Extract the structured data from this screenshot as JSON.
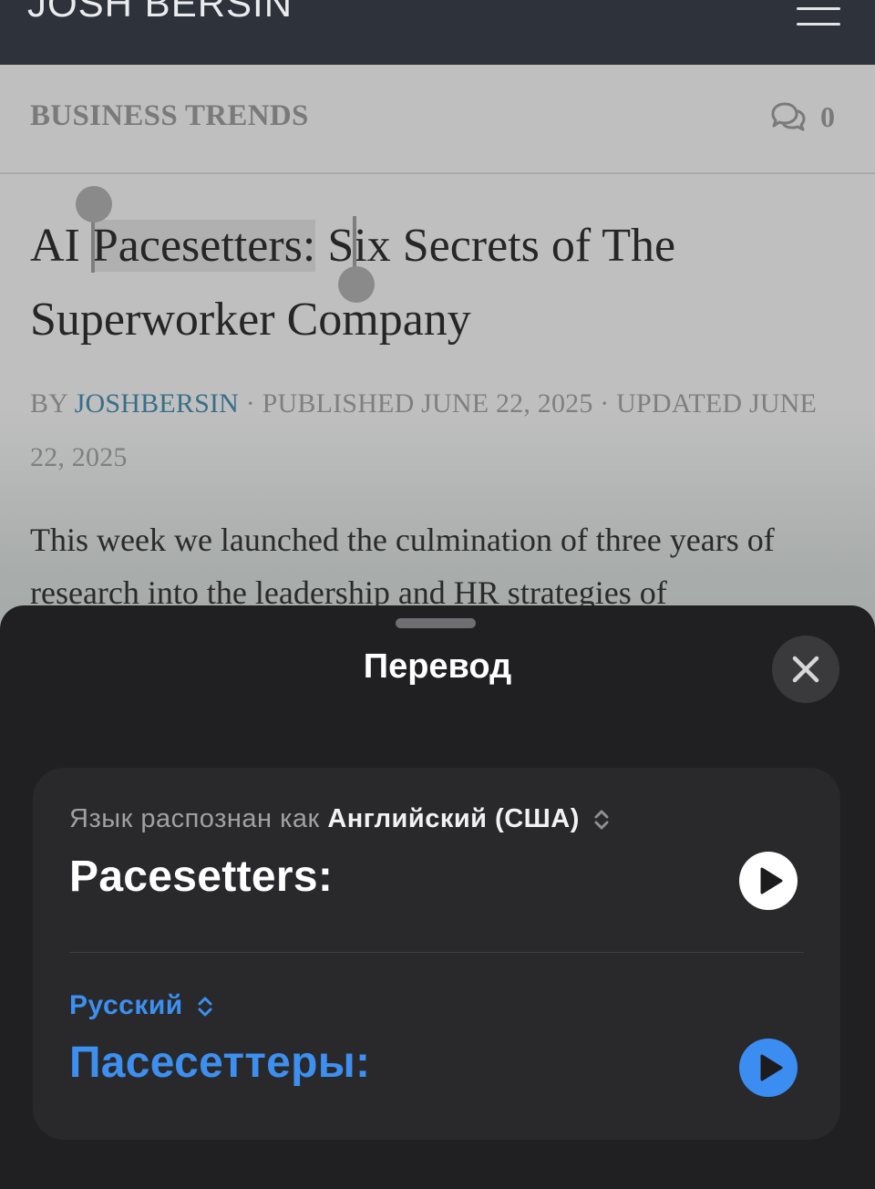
{
  "site": {
    "logo": "JOSH BERSIN"
  },
  "article": {
    "category": "BUSINESS TRENDS",
    "comment_count": "0",
    "title_before": "AI ",
    "title_selected": "Pacesetters:",
    "title_after": " Six Secrets of The Superworker Company",
    "byline_by": "BY ",
    "author": "JOSHBERSIN",
    "byline_dates": " · PUBLISHED JUNE 22, 2025 · UPDATED JUNE 22, 2025",
    "excerpt": "This week we launched the culmination of three years of research into the leadership and HR strategies of"
  },
  "translate": {
    "sheet_title": "Перевод",
    "detected_label": "Язык распознан как ",
    "source_language": "Английский (США)",
    "source_text": "Pacesetters:",
    "target_language": "Русский",
    "target_text": "Пасесеттеры:"
  },
  "colors": {
    "header_bg": "#2d323b",
    "sheet_bg": "#202022",
    "card_bg": "#29292b",
    "accent_blue": "#3d8ff0",
    "author_link": "#386f88"
  },
  "icons": {
    "menu": "hamburger-icon",
    "comments": "comments-icon",
    "close": "close-icon",
    "play": "play-icon",
    "chevron": "chevron-up-down-icon"
  }
}
